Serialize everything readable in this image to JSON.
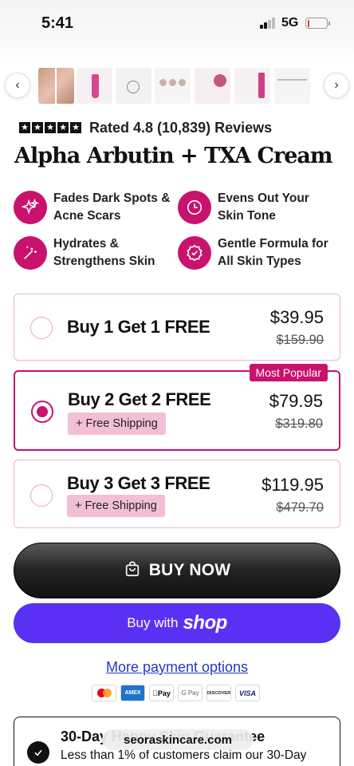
{
  "status_bar": {
    "time": "5:41",
    "network": "5G",
    "battery_level": 0.1,
    "battery_color": "#e53935"
  },
  "gallery": {
    "prev_icon": "chevron-left-icon",
    "next_icon": "chevron-right-icon",
    "thumbnail_count": 7
  },
  "rating": {
    "stars": 5,
    "text": "Rated 4.8 (10,839) Reviews"
  },
  "product": {
    "title": "Alpha Arbutin + TXA Cream"
  },
  "benefits": [
    {
      "icon": "sparkle-icon",
      "line1": "Fades Dark Spots &",
      "line2": "Acne Scars"
    },
    {
      "icon": "clock-icon",
      "line1": "Evens Out Your",
      "line2": "Skin Tone"
    },
    {
      "icon": "magic-wand-icon",
      "line1": "Hydrates &",
      "line2": "Strengthens Skin"
    },
    {
      "icon": "check-badge-icon",
      "line1": "Gentle Formula for",
      "line2": "All Skin Types"
    }
  ],
  "offers": [
    {
      "title": "Buy 1 Get 1 FREE",
      "price": "$39.95",
      "old_price": "$159.90",
      "selected": false
    },
    {
      "title": "Buy 2 Get 2 FREE",
      "price": "$79.95",
      "old_price": "$319.80",
      "badge": "+ Free Shipping",
      "tag": "Most Popular",
      "selected": true
    },
    {
      "title": "Buy 3 Get 3 FREE",
      "price": "$119.95",
      "old_price": "$479.70",
      "badge": "+ Free Shipping",
      "selected": false
    }
  ],
  "buttons": {
    "buy_now": "BUY NOW",
    "buy_now_icon": "shopping-bag-icon",
    "shop_pay_prefix": "Buy with",
    "shop_pay_logo": "shop",
    "more_options": "More payment options"
  },
  "payment_methods": [
    "mastercard",
    "AMEX",
    "Pay",
    "G Pay",
    "DISCOVER",
    "VISA"
  ],
  "guarantee": {
    "title": "30-Day Happy Skin Guarantee",
    "subtitle": "Less than 1% of customers claim our 30-Day"
  },
  "browser": {
    "domain": "seoraskincare.com"
  },
  "colors": {
    "brand_magenta": "#c8126e",
    "badge_pink": "#f2bfd7",
    "shop_purple": "#5a31f4",
    "link_blue": "#2536c9"
  }
}
